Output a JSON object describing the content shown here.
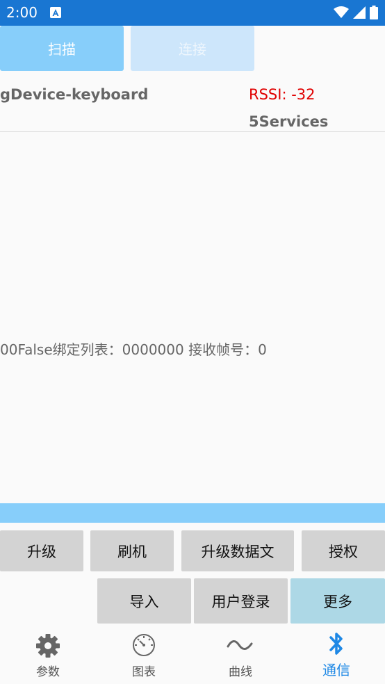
{
  "status_bar": {
    "time": "2:00"
  },
  "toolbar": {
    "scan_label": "扫描",
    "connect_label": "连接"
  },
  "device": {
    "name": "gDevice-keyboard",
    "rssi": "RSSI: -32",
    "services": "5Services"
  },
  "status_line": "00False绑定列表：0000000   接收帧号：0",
  "actions": {
    "upgrade": "升级",
    "flash": "刷机",
    "upgrade_data": "升级数据文",
    "authorize": "授权",
    "import": "导入",
    "login": "用户登录",
    "more": "更多"
  },
  "bottom_nav": {
    "params": "参数",
    "chart": "图表",
    "curve": "曲线",
    "comm": "通信"
  },
  "colors": {
    "status_bar": "#1976d2",
    "primary_button": "#87cefa",
    "disabled_button": "#cde6fb",
    "rssi": "#e00000",
    "action_button": "#d3d3d3",
    "more_button": "#add8e6",
    "active_tab": "#1e88e5"
  },
  "icons": {
    "params": "gear-icon",
    "chart": "gauge-icon",
    "curve": "wave-icon",
    "comm": "bluetooth-icon"
  }
}
